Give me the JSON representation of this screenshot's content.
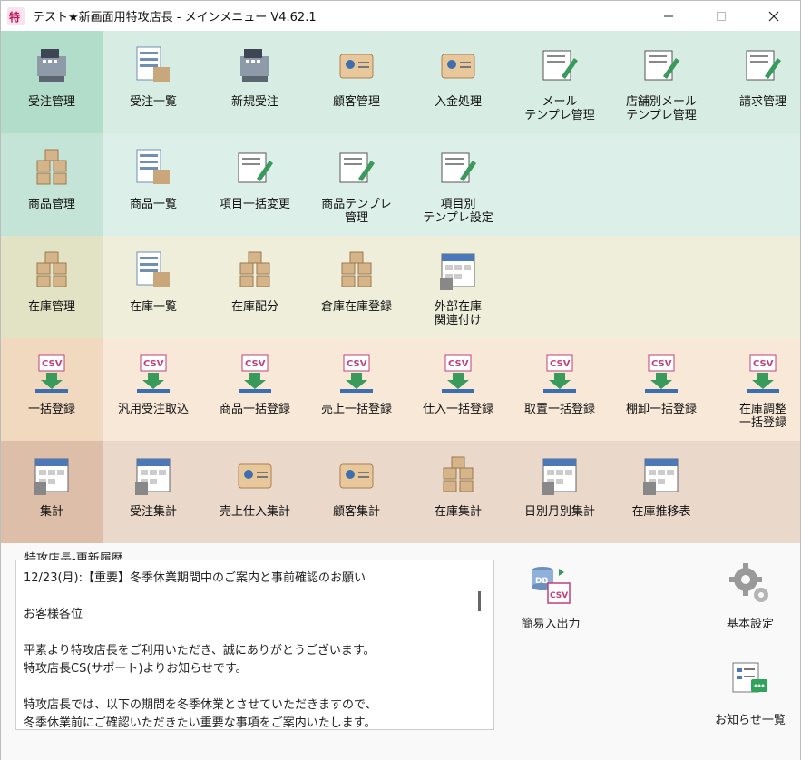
{
  "window": {
    "title": "テスト★新画面用特攻店長 - メインメニュー   V4.62.1"
  },
  "rows": [
    {
      "name": "order",
      "buttons": [
        {
          "label": "受注管理",
          "icon": "register-icon"
        },
        {
          "label": "受注一覧",
          "icon": "list-register-icon"
        },
        {
          "label": "新規受注",
          "icon": "register-add-icon"
        },
        {
          "label": "顧客管理",
          "icon": "customer-card-icon"
        },
        {
          "label": "入金処理",
          "icon": "payment-card-icon"
        },
        {
          "label": "メール\nテンプレ管理",
          "icon": "mail-edit-icon"
        },
        {
          "label": "店舗別メール\nテンプレ管理",
          "icon": "shop-mail-icon"
        },
        {
          "label": "請求管理",
          "icon": "invoice-icon"
        }
      ]
    },
    {
      "name": "product",
      "buttons": [
        {
          "label": "商品管理",
          "icon": "shopping-bag-icon"
        },
        {
          "label": "商品一覧",
          "icon": "product-list-icon"
        },
        {
          "label": "項目一括変更",
          "icon": "edit-document-icon"
        },
        {
          "label": "商品テンプレ\n管理",
          "icon": "template-brush-icon"
        },
        {
          "label": "項目別\nテンプレ設定",
          "icon": "caption-template-icon"
        }
      ]
    },
    {
      "name": "stock",
      "buttons": [
        {
          "label": "在庫管理",
          "icon": "boxes-icon"
        },
        {
          "label": "在庫一覧",
          "icon": "stock-list-icon"
        },
        {
          "label": "在庫配分",
          "icon": "stock-distribute-icon"
        },
        {
          "label": "倉庫在庫登録",
          "icon": "warehouse-icon"
        },
        {
          "label": "外部在庫\n関連付け",
          "icon": "external-stock-icon"
        }
      ]
    },
    {
      "name": "import",
      "buttons": [
        {
          "label": "一括登録",
          "icon": "csv-import-icon"
        },
        {
          "label": "汎用受注取込",
          "icon": "order-import-icon"
        },
        {
          "label": "商品一括登録",
          "icon": "product-import-icon"
        },
        {
          "label": "売上一括登録",
          "icon": "sales-import-icon"
        },
        {
          "label": "仕入一括登録",
          "icon": "purchase-import-icon"
        },
        {
          "label": "取置一括登録",
          "icon": "reserve-import-icon"
        },
        {
          "label": "棚卸一括登録",
          "icon": "inventory-import-icon"
        },
        {
          "label": "在庫調整\n一括登録",
          "icon": "stock-adjust-import-icon"
        }
      ]
    },
    {
      "name": "report",
      "buttons": [
        {
          "label": "集計",
          "icon": "ledger-calculator-icon"
        },
        {
          "label": "受注集計",
          "icon": "order-total-icon"
        },
        {
          "label": "売上仕入集計",
          "icon": "sales-purchase-total-icon"
        },
        {
          "label": "顧客集計",
          "icon": "customer-total-icon"
        },
        {
          "label": "在庫集計",
          "icon": "stock-total-icon"
        },
        {
          "label": "日別月別集計",
          "icon": "calendar-total-icon"
        },
        {
          "label": "在庫推移表",
          "icon": "stock-chart-icon"
        }
      ]
    }
  ],
  "news": {
    "title": "特攻店長-更新履歴",
    "body": "12/23(月):【重要】冬季休業期間中のご案内と事前確認のお願い\n\nお客様各位\n\n平素より特攻店長をご利用いただき、誠にありがとうございます。\n特攻店長CS(サポート)よりお知らせです。\n\n特攻店長では、以下の期間を冬季休業とさせていただきますので、\n冬季休業前にご確認いただきたい重要な事項をご案内いたします。"
  },
  "tools": {
    "import_export": {
      "label": "簡易入出力",
      "icon": "db-csv-icon"
    },
    "settings": {
      "label": "基本設定",
      "icon": "gears-icon"
    },
    "notices": {
      "label": "お知らせ一覧",
      "icon": "notice-list-icon"
    }
  }
}
